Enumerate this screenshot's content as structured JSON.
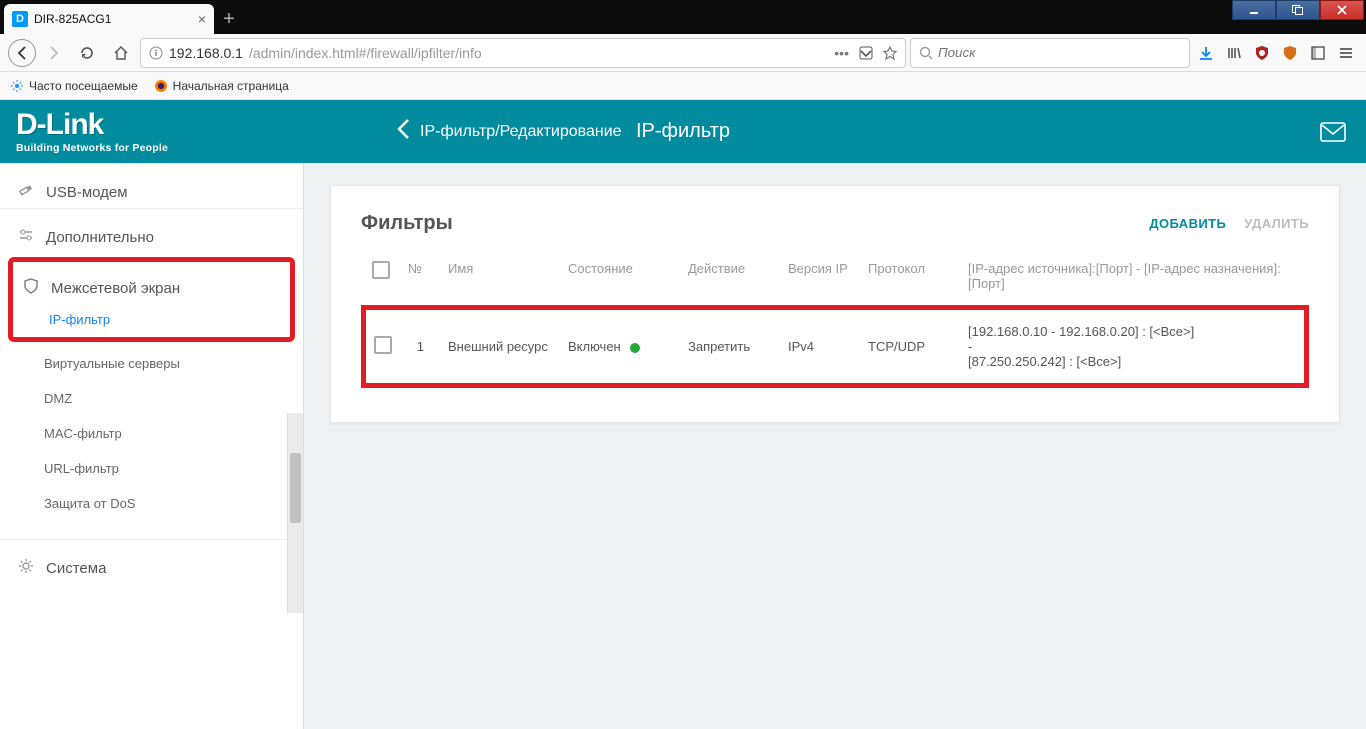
{
  "browser": {
    "tab_title": "DIR-825ACG1",
    "url_prefix": "192.168.0.1",
    "url_suffix": "/admin/index.html#/firewall/ipfilter/info",
    "search_placeholder": "Поиск",
    "bookmarks": {
      "most_visited": "Часто посещаемые",
      "start_page": "Начальная страница"
    }
  },
  "header": {
    "logo": "D-Link",
    "logo_sub": "Building Networks for People",
    "back_label": "IP-фильтр/Редактирование",
    "page_title": "IP-фильтр"
  },
  "sidebar": {
    "usb": "USB-модем",
    "advanced": "Дополнительно",
    "firewall": "Межсетевой экран",
    "firewall_items": {
      "ipfilter": "IP-фильтр",
      "vservers": "Виртуальные серверы",
      "dmz": "DMZ",
      "mac": "MAC-фильтр",
      "url": "URL-фильтр",
      "dos": "Защита от DoS"
    },
    "system": "Система"
  },
  "card": {
    "title": "Фильтры",
    "actions": {
      "add": "ДОБАВИТЬ",
      "del": "УДАЛИТЬ"
    }
  },
  "table": {
    "headers": {
      "num": "№",
      "name": "Имя",
      "state": "Состояние",
      "action": "Действие",
      "ipver": "Версия IP",
      "proto": "Протокол",
      "addr": "[IP-адрес источника]:[Порт] - [IP-адрес назначения]:[Порт]"
    },
    "rows": [
      {
        "num": "1",
        "name": "Внешний ресурс",
        "state": "Включен",
        "action": "Запретить",
        "ipver": "IPv4",
        "proto": "TCP/UDP",
        "addr1": "[192.168.0.10 - 192.168.0.20] : [<Все>]",
        "addr_dash": "-",
        "addr2": "[87.250.250.242] : [<Все>]"
      }
    ]
  }
}
